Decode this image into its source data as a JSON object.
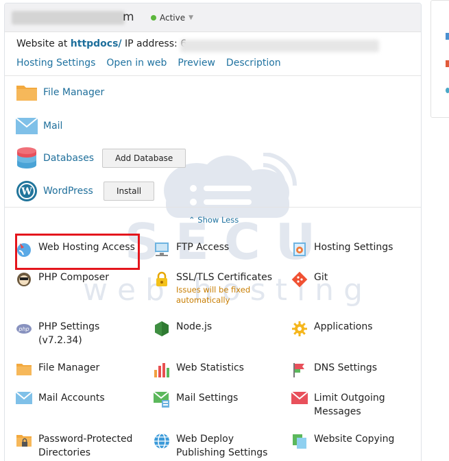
{
  "header": {
    "name_tail": "m",
    "status": "Active"
  },
  "website": {
    "prefix": "Website at",
    "docroot": "httpdocs/",
    "ip_label": "IP address: 6"
  },
  "links": [
    "Hosting Settings",
    "Open in web",
    "Preview",
    "Description"
  ],
  "services": [
    {
      "label": "File Manager",
      "icon": "folder-icon"
    },
    {
      "label": "Mail",
      "icon": "mail-icon"
    },
    {
      "label": "Databases",
      "icon": "database-icon",
      "button": "Add Database"
    },
    {
      "label": "WordPress",
      "icon": "wordpress-icon",
      "button": "Install"
    }
  ],
  "show_less": "Show Less",
  "tools": [
    {
      "label": "Web Hosting Access",
      "icon": "web-hosting-access-icon",
      "highlighted": true
    },
    {
      "label": "FTP Access",
      "icon": "ftp-icon"
    },
    {
      "label": "Hosting Settings",
      "icon": "hosting-settings-icon"
    },
    {
      "label": "PHP Composer",
      "icon": "php-composer-icon"
    },
    {
      "label": "SSL/TLS Certificates",
      "icon": "ssl-icon",
      "note": "Issues will be fixed automatically"
    },
    {
      "label": "Git",
      "icon": "git-icon"
    },
    {
      "label": "PHP Settings",
      "sublabel": "(v7.2.34)",
      "icon": "php-icon"
    },
    {
      "label": "Node.js",
      "icon": "nodejs-icon"
    },
    {
      "label": "Applications",
      "icon": "gear-icon"
    },
    {
      "label": "File Manager",
      "icon": "folder-icon"
    },
    {
      "label": "Web Statistics",
      "icon": "bar-chart-icon"
    },
    {
      "label": "DNS Settings",
      "icon": "dns-icon"
    },
    {
      "label": "Mail Accounts",
      "icon": "mail-icon"
    },
    {
      "label": "Mail Settings",
      "icon": "mail-settings-icon"
    },
    {
      "label": "Limit Outgoing Messages",
      "icon": "mail-limit-icon"
    },
    {
      "label": "Password-Protected Directories",
      "icon": "lock-folder-icon"
    },
    {
      "label": "Web Deploy Publishing Settings",
      "icon": "web-deploy-icon"
    },
    {
      "label": "Website Copying",
      "icon": "copy-icon"
    }
  ],
  "watermark": {
    "line1": "SECU",
    "line2": "web hosting"
  },
  "colors": {
    "link": "#1f72a0",
    "status_dot": "#5bb63b",
    "highlight": "#e4151c",
    "warning": "#c87d00"
  }
}
